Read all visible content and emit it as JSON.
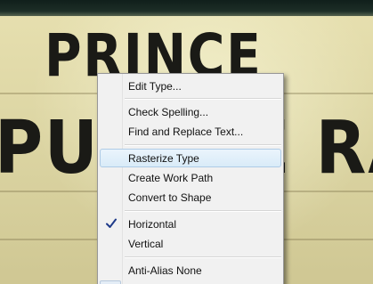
{
  "canvas": {
    "sign_line_1": "PRINCE",
    "sign_line_2": "PURPLE RAIN"
  },
  "context_menu": {
    "items": [
      {
        "label": "Edit Type..."
      },
      {
        "label": "Check Spelling..."
      },
      {
        "label": "Find and Replace Text..."
      },
      {
        "label": "Rasterize Type",
        "highlighted": true
      },
      {
        "label": "Create Work Path"
      },
      {
        "label": "Convert to Shape"
      },
      {
        "label": "Horizontal",
        "checked": true
      },
      {
        "label": "Vertical"
      },
      {
        "label": "Anti-Alias None"
      }
    ],
    "highlight_color": "#d9ebf8",
    "check_color": "#1f3b8a"
  }
}
